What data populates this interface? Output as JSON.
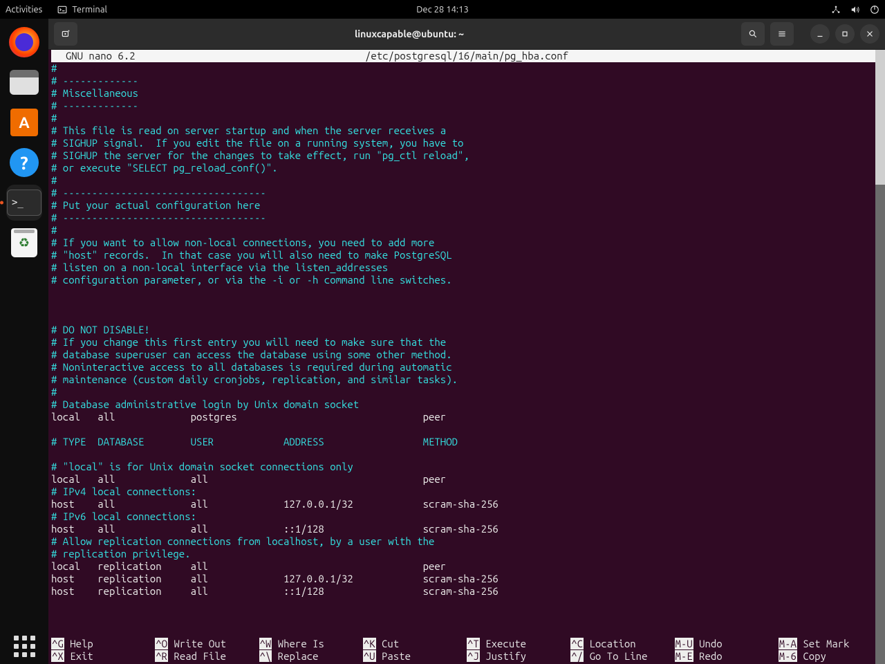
{
  "topbar": {
    "activities": "Activities",
    "app_label": "Terminal",
    "clock": "Dec 28  14:13"
  },
  "dock": {
    "items": [
      {
        "name": "firefox"
      },
      {
        "name": "files"
      },
      {
        "name": "software"
      },
      {
        "name": "help"
      },
      {
        "name": "terminal",
        "running": true
      },
      {
        "name": "trash"
      }
    ]
  },
  "terminal": {
    "title": "linuxcapable@ubuntu: ~",
    "nano": {
      "app": "GNU nano 6.2",
      "file": "/etc/postgresql/16/main/pg_hba.conf",
      "lines": [
        {
          "t": "#",
          "c": true
        },
        {
          "t": "# -------------",
          "c": true
        },
        {
          "t": "# Miscellaneous",
          "c": true
        },
        {
          "t": "# -------------",
          "c": true
        },
        {
          "t": "#",
          "c": true
        },
        {
          "t": "# This file is read on server startup and when the server receives a",
          "c": true
        },
        {
          "t": "# SIGHUP signal.  If you edit the file on a running system, you have to",
          "c": true
        },
        {
          "t": "# SIGHUP the server for the changes to take effect, run \"pg_ctl reload\",",
          "c": true
        },
        {
          "t": "# or execute \"SELECT pg_reload_conf()\".",
          "c": true
        },
        {
          "t": "#",
          "c": true
        },
        {
          "t": "# -----------------------------------",
          "c": true
        },
        {
          "t": "# Put your actual configuration here",
          "c": true
        },
        {
          "t": "# -----------------------------------",
          "c": true
        },
        {
          "t": "#",
          "c": true
        },
        {
          "t": "# If you want to allow non-local connections, you need to add more",
          "c": true
        },
        {
          "t": "# \"host\" records.  In that case you will also need to make PostgreSQL",
          "c": true
        },
        {
          "t": "# listen on a non-local interface via the listen_addresses",
          "c": true
        },
        {
          "t": "# configuration parameter, or via the -i or -h command line switches.",
          "c": true
        },
        {
          "t": "",
          "c": false
        },
        {
          "t": "",
          "c": false
        },
        {
          "t": "",
          "c": false
        },
        {
          "t": "# DO NOT DISABLE!",
          "c": true
        },
        {
          "t": "# If you change this first entry you will need to make sure that the",
          "c": true
        },
        {
          "t": "# database superuser can access the database using some other method.",
          "c": true
        },
        {
          "t": "# Noninteractive access to all databases is required during automatic",
          "c": true
        },
        {
          "t": "# maintenance (custom daily cronjobs, replication, and similar tasks).",
          "c": true
        },
        {
          "t": "#",
          "c": true
        },
        {
          "t": "# Database administrative login by Unix domain socket",
          "c": true
        },
        {
          "t": "local   all             postgres                                peer",
          "c": false
        },
        {
          "t": "",
          "c": false
        },
        {
          "t": "# TYPE  DATABASE        USER            ADDRESS                 METHOD",
          "c": true
        },
        {
          "t": "",
          "c": false
        },
        {
          "t": "# \"local\" is for Unix domain socket connections only",
          "c": true
        },
        {
          "t": "local   all             all                                     peer",
          "c": false
        },
        {
          "t": "# IPv4 local connections:",
          "c": true
        },
        {
          "t": "host    all             all             127.0.0.1/32            scram-sha-256",
          "c": false
        },
        {
          "t": "# IPv6 local connections:",
          "c": true
        },
        {
          "t": "host    all             all             ::1/128                 scram-sha-256",
          "c": false
        },
        {
          "t": "# Allow replication connections from localhost, by a user with the",
          "c": true
        },
        {
          "t": "# replication privilege.",
          "c": true
        },
        {
          "t": "local   replication     all                                     peer",
          "c": false
        },
        {
          "t": "host    replication     all             127.0.0.1/32            scram-sha-256",
          "c": false
        },
        {
          "t": "host    replication     all             ::1/128                 scram-sha-256",
          "c": false
        }
      ],
      "shortcuts_row1": [
        {
          "k": "^G",
          "l": "Help"
        },
        {
          "k": "^O",
          "l": "Write Out"
        },
        {
          "k": "^W",
          "l": "Where Is"
        },
        {
          "k": "^K",
          "l": "Cut"
        },
        {
          "k": "^T",
          "l": "Execute"
        },
        {
          "k": "^C",
          "l": "Location"
        },
        {
          "k": "M-U",
          "l": "Undo"
        },
        {
          "k": "M-A",
          "l": "Set Mark"
        }
      ],
      "shortcuts_row2": [
        {
          "k": "^X",
          "l": "Exit"
        },
        {
          "k": "^R",
          "l": "Read File"
        },
        {
          "k": "^\\",
          "l": "Replace"
        },
        {
          "k": "^U",
          "l": "Paste"
        },
        {
          "k": "^J",
          "l": "Justify"
        },
        {
          "k": "^/",
          "l": "Go To Line"
        },
        {
          "k": "M-E",
          "l": "Redo"
        },
        {
          "k": "M-6",
          "l": "Copy"
        }
      ]
    }
  }
}
